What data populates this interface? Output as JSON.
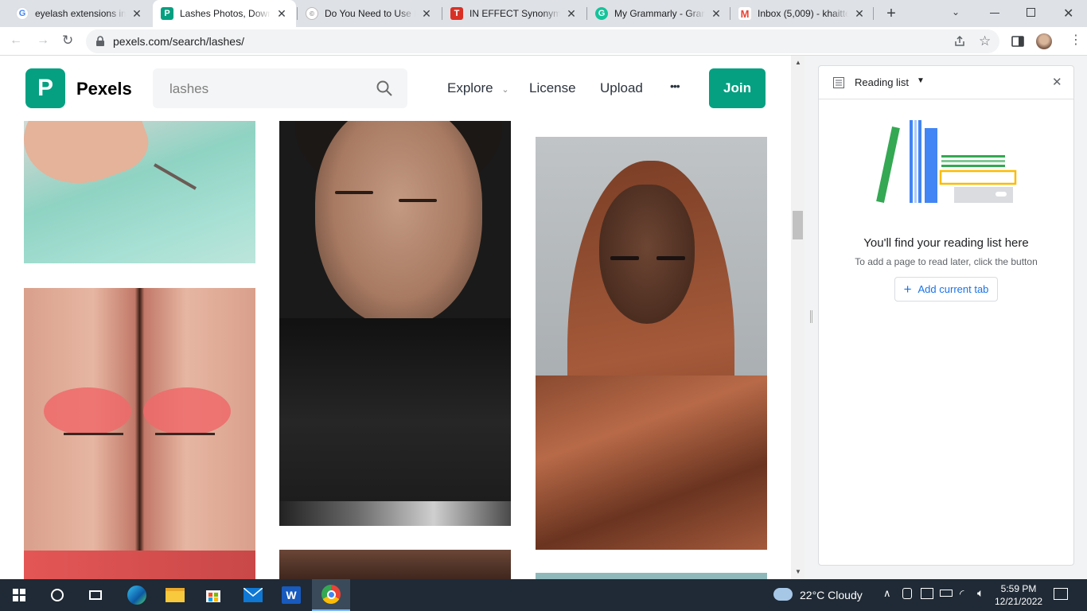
{
  "browser": {
    "tabs": [
      {
        "title": "eyelash extensions im",
        "favicon": "google-g-icon",
        "active": false
      },
      {
        "title": "Lashes Photos, Downl",
        "favicon": "pexels-icon",
        "active": true
      },
      {
        "title": "Do You Need to Use E",
        "favicon": "generic-site-icon",
        "active": false
      },
      {
        "title": "IN EFFECT Synonyms",
        "favicon": "thesaurus-icon",
        "active": false
      },
      {
        "title": "My Grammarly - Gram",
        "favicon": "grammarly-icon",
        "active": false
      },
      {
        "title": "Inbox (5,009) - khaitte",
        "favicon": "gmail-icon",
        "active": false
      }
    ],
    "url": "pexels.com/search/lashes/"
  },
  "pexels": {
    "logo_letter": "P",
    "brand": "Pexels",
    "search_value": "lashes",
    "nav": {
      "explore": "Explore",
      "license": "License",
      "upload": "Upload",
      "more": "•••",
      "join": "Join"
    },
    "brand_color": "#05a081"
  },
  "reading_list": {
    "title": "Reading list",
    "empty_title": "You'll find your reading list here",
    "empty_sub": "To add a page to read later, click the button",
    "add_button": "Add current tab"
  },
  "taskbar": {
    "weather": "22°C  Cloudy",
    "time": "5:59 PM",
    "date": "12/21/2022"
  }
}
